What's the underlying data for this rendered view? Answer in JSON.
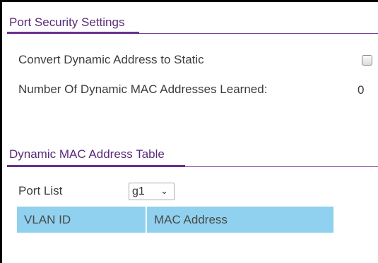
{
  "port_security": {
    "title": "Port Security Settings",
    "convert_label": "Convert Dynamic Address to Static",
    "convert_checked": false,
    "learned_label": "Number Of Dynamic MAC Addresses Learned:",
    "learned_value": "0"
  },
  "dynamic_table": {
    "title": "Dynamic MAC Address Table",
    "port_list_label": "Port List",
    "port_list_selected": "g1",
    "columns": [
      "VLAN ID",
      "MAC Address"
    ]
  },
  "colors": {
    "title_text": "#5a2a78",
    "accent_line": "#7b3f9e",
    "table_header_bg": "#8fd1ee"
  }
}
